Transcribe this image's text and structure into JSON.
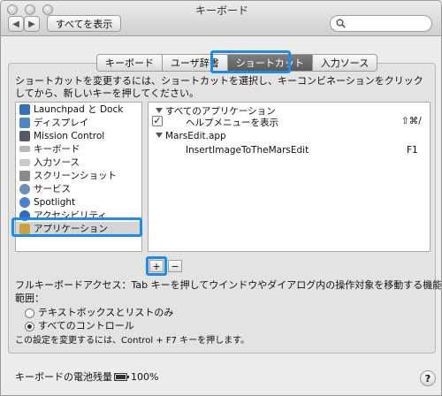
{
  "window": {
    "title": "キーボード"
  },
  "toolbar": {
    "show_all": "すべてを表示",
    "search_placeholder": "",
    "back_icon": "chevron-left",
    "forward_icon": "chevron-right"
  },
  "tabs": [
    {
      "label": "キーボード",
      "active": false
    },
    {
      "label": "ユーザ辞書",
      "active": false
    },
    {
      "label": "ショートカット",
      "active": true
    },
    {
      "label": "入力ソース",
      "active": false
    }
  ],
  "description": "ショートカットを変更するには、ショートカットを選択し、キーコンビネーションをクリックしてから、新しいキーを押してください。",
  "categories": [
    {
      "label": "Launchpad と Dock",
      "color": "#3b6fb5"
    },
    {
      "label": "ディスプレイ",
      "color": "#4a86c8"
    },
    {
      "label": "Mission Control",
      "color": "#555a66"
    },
    {
      "label": "キーボード",
      "color": "#b8b8b8"
    },
    {
      "label": "入力ソース",
      "color": "#c9c9c9"
    },
    {
      "label": "スクリーンショット",
      "color": "#8a8a8a"
    },
    {
      "label": "サービス",
      "color": "#6f8fb8"
    },
    {
      "label": "Spotlight",
      "color": "#4b7fcf"
    },
    {
      "label": "アクセシビリティ",
      "color": "#2e68c4"
    },
    {
      "label": "アプリケーション",
      "color": "#c9a23b",
      "selected": true
    }
  ],
  "shortcuts": {
    "group1": {
      "label": "すべてのアプリケーション"
    },
    "item1": {
      "label": "ヘルプメニューを表示",
      "key": "⇧⌘/",
      "checked": true
    },
    "group2": {
      "label": "MarsEdit.app"
    },
    "item2": {
      "label": "InsertImageToTheMarsEdit",
      "key": "F1"
    }
  },
  "list_buttons": {
    "add": "+",
    "remove": "−"
  },
  "full_keyboard_access": {
    "label_line1": "フルキーボードアクセス：Tab キーを押してウインドウやダイアログ内の操作対象を移動する機能の適用",
    "label_line2": "範囲：",
    "option1": "テキストボックスとリストのみ",
    "option2": "すべてのコントロール",
    "selected": 2,
    "note": "この設定を変更するには、Control + F7 キーを押します。"
  },
  "battery": {
    "label": "キーボードの電池残量：",
    "value": "100%",
    "level": 1.0
  },
  "help": {
    "label": "?"
  },
  "colors": {
    "highlight": "#1a8cf0",
    "active_tab": "#5a5a5a"
  }
}
